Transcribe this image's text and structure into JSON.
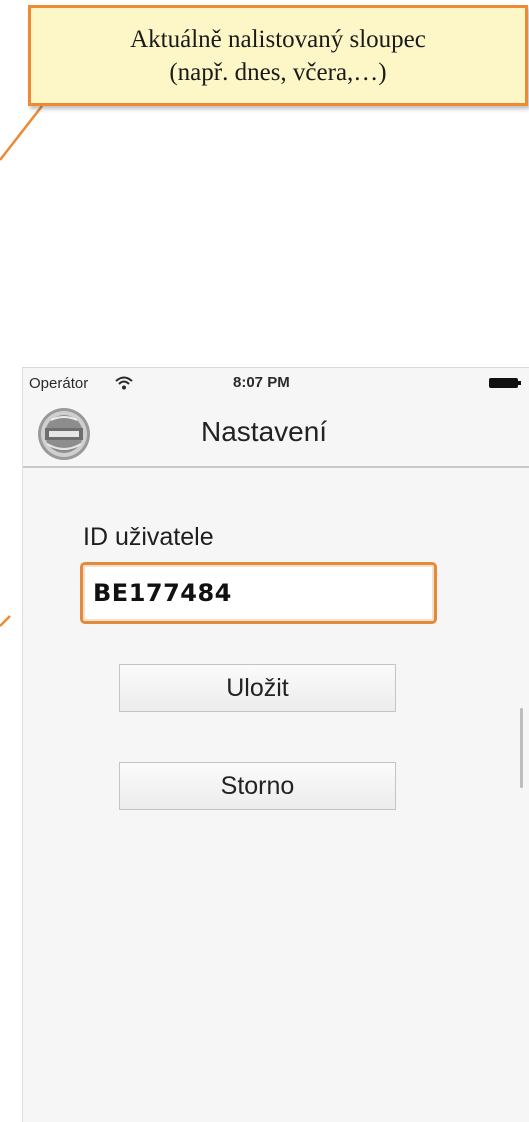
{
  "callout": {
    "line1": "Aktuálně nalistovaný sloupec",
    "line2": "(např. dnes, včera,…)",
    "border_color": "#ec8a35",
    "fill_color": "#fdf6c6"
  },
  "status_bar": {
    "carrier": "Operátor",
    "time": "8:07 PM",
    "wifi_icon": "wifi-icon",
    "battery_icon": "battery-icon"
  },
  "nav": {
    "title": "Nastavení",
    "logo_icon": "app-logo"
  },
  "form": {
    "user_id_label": "ID uživatele",
    "user_id_value": "BE177484",
    "focus_color": "#e5893a"
  },
  "buttons": {
    "save": "Uložit",
    "cancel": "Storno"
  }
}
